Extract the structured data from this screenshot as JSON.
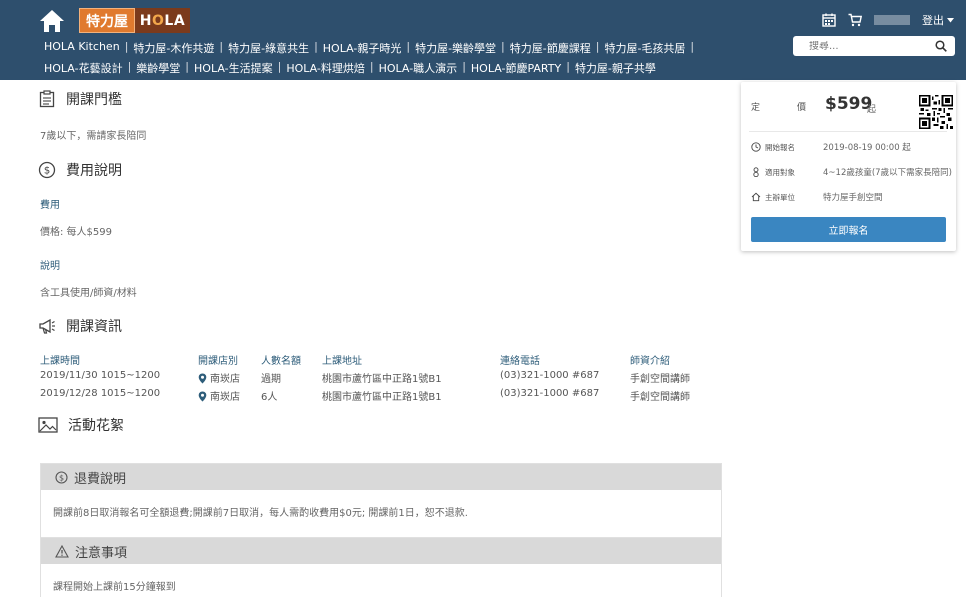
{
  "header": {
    "logo_left": "特力屋",
    "logo_right_a": "H",
    "logo_right_o": "O",
    "logo_right_b": "LA",
    "nav_row1": [
      "HOLA Kitchen",
      "特力屋-木作共遊",
      "特力屋-綠意共生",
      "HOLA-親子時光",
      "特力屋-樂齡學堂",
      "特力屋-節慶課程",
      "特力屋-毛孩共居"
    ],
    "nav_row2": [
      "HOLA-花藝設計",
      "樂齡學堂",
      "HOLA-生活提案",
      "HOLA-料理烘焙",
      "HOLA-職人演示",
      "HOLA-節慶PARTY",
      "特力屋-親子共學"
    ],
    "logout": "登出",
    "search_placeholder": "搜尋..."
  },
  "main": {
    "threshold_title": "開課門檻",
    "threshold_text": "7歲以下，需請家長陪同",
    "fee_title": "費用說明",
    "fee_label": "費用",
    "fee_text": "價格: 每人$599",
    "desc_label": "說明",
    "desc_text": "含工具使用/師資/材料",
    "course_title": "開課資訊",
    "course_headers": [
      "上課時間",
      "開課店別",
      "人數名額",
      "上課地址",
      "連絡電話",
      "師資介紹"
    ],
    "course_rows": [
      [
        "2019/11/30 1015~1200",
        "南崁店",
        "過期",
        "桃園市蘆竹區中正路1號B1",
        "(03)321-1000 #687",
        "手創空間講師"
      ],
      [
        "2019/12/28 1015~1200",
        "南崁店",
        "6人",
        "桃園市蘆竹區中正路1號B1",
        "(03)321-1000 #687",
        "手創空間講師"
      ]
    ],
    "gallery_title": "活動花絮",
    "refund_title": "退費說明",
    "refund_text": "開課前8日取消報名可全額退費;開課前7日取消，每人需酌收費用$0元; 開課前1日，恕不退款.",
    "notice_title": "注意事項",
    "notice_text": "課程開始上課前15分鐘報到"
  },
  "card": {
    "price_label_a": "定",
    "price_label_b": "價",
    "price": "$599",
    "price_suffix": "起",
    "start_key": "開始報名",
    "start_val": "2019-08-19 00:00 起",
    "target_key": "適用對象",
    "target_val": "4~12歲孩童(7歲以下需家長陪同)",
    "host_key": "主辦單位",
    "host_val": "特力屋手創空間",
    "signup": "立即報名"
  },
  "colors": {
    "header_bg": "#2e4f6d",
    "button_blue": "#3a86c1",
    "logo_orange": "#e07a2e",
    "logo_brown": "#7b3a1c"
  }
}
